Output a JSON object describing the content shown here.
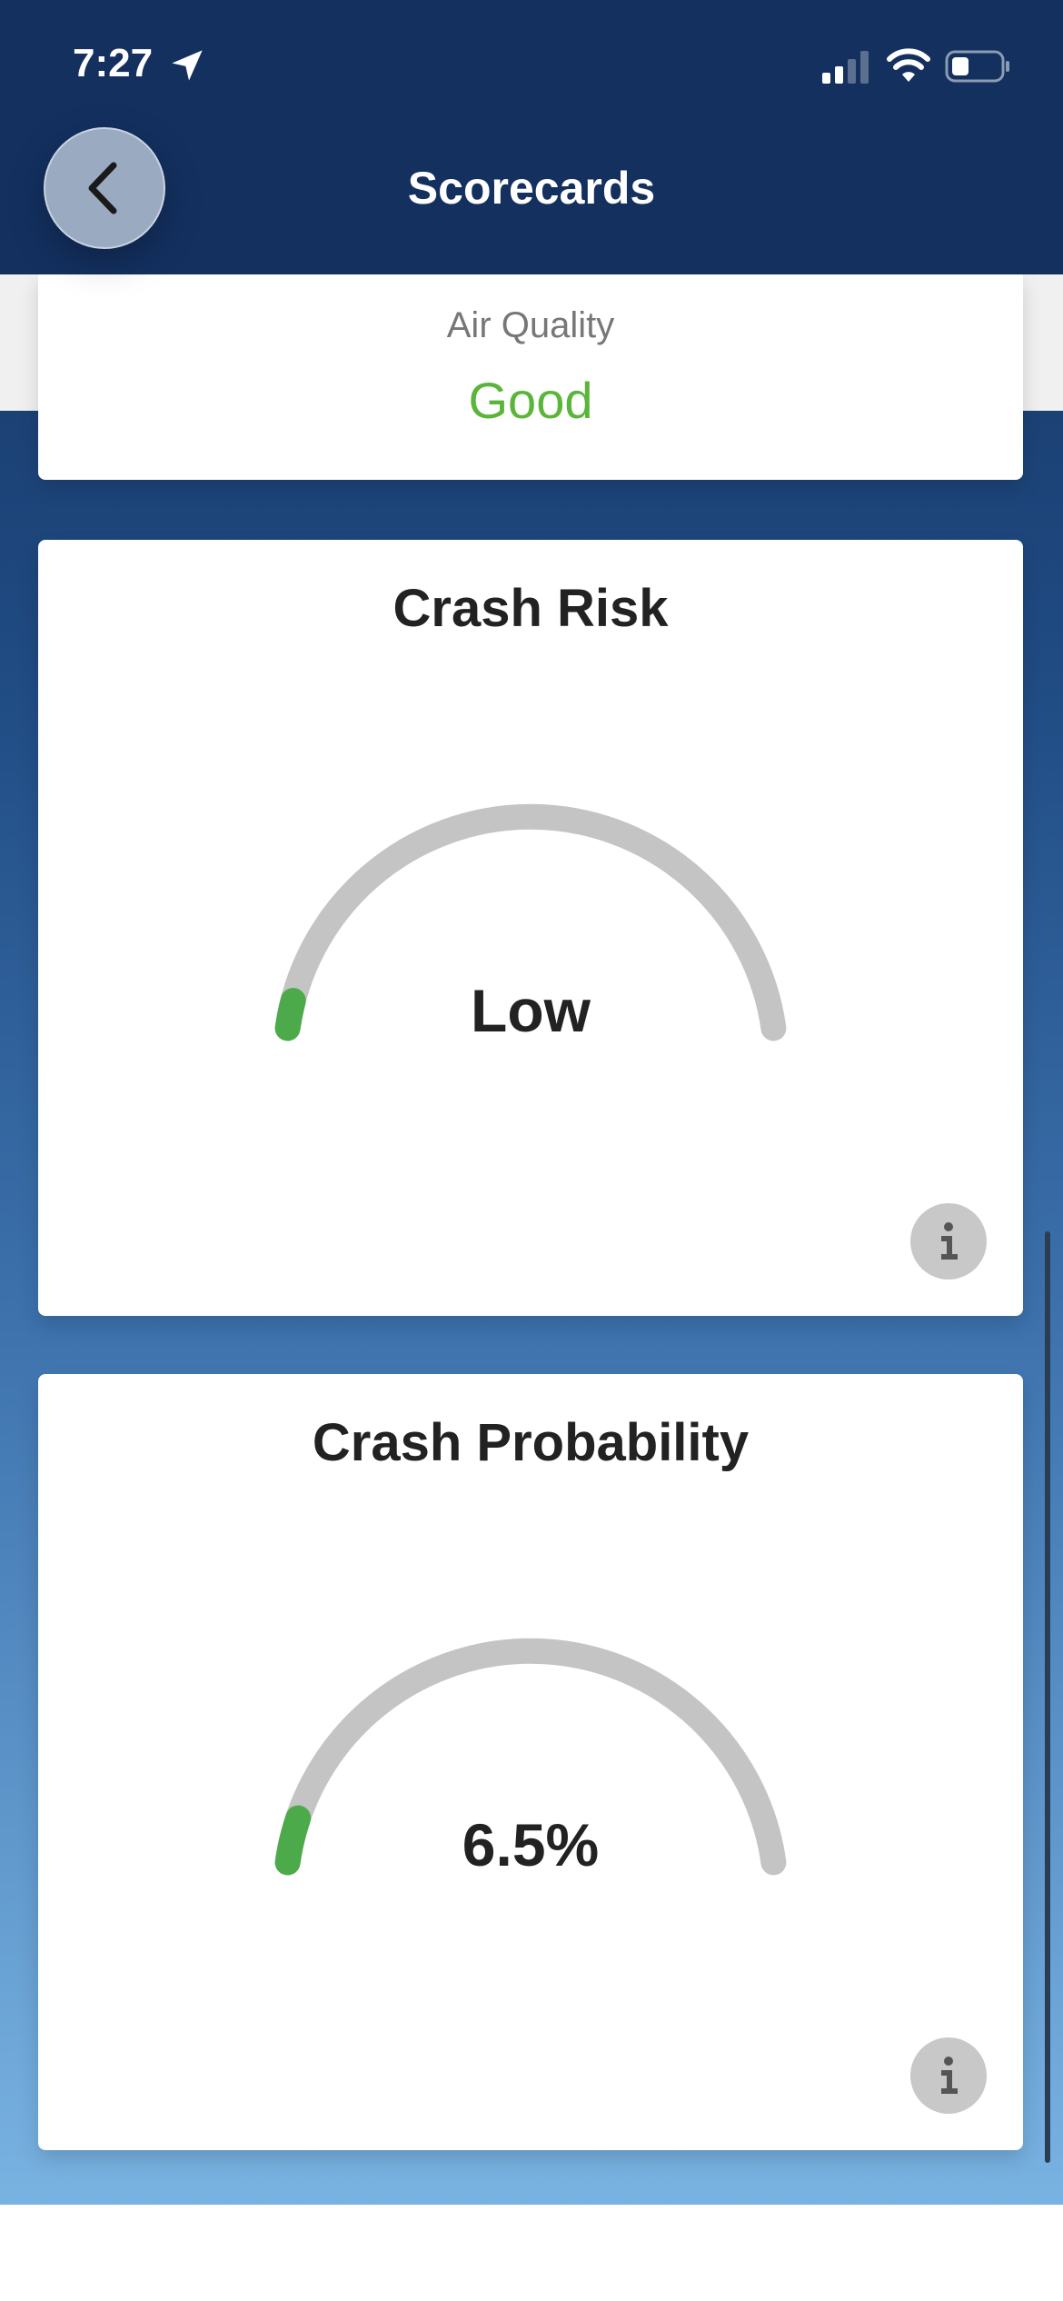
{
  "status_bar": {
    "time": "7:27",
    "icons": [
      "location-arrow-icon",
      "cellular-signal-icon",
      "wifi-icon",
      "battery-icon"
    ]
  },
  "header": {
    "title": "Scorecards",
    "back_icon": "chevron-left-icon"
  },
  "air_quality": {
    "label": "Air Quality",
    "value": "Good",
    "value_color": "#5ab53a"
  },
  "crash_risk": {
    "title": "Crash Risk",
    "value": "Low",
    "gauge_level": 0.04,
    "gauge_color": "#4caa4a",
    "track_color": "#c4c4c4",
    "info_icon": "info-icon"
  },
  "crash_probability": {
    "title": "Crash Probability",
    "value": "6.5%",
    "gauge_level": 0.065,
    "gauge_color": "#4caa4a",
    "track_color": "#c4c4c4",
    "info_icon": "info-icon"
  },
  "colors": {
    "header_bg": "#13305f",
    "accent_good": "#5ab53a"
  }
}
